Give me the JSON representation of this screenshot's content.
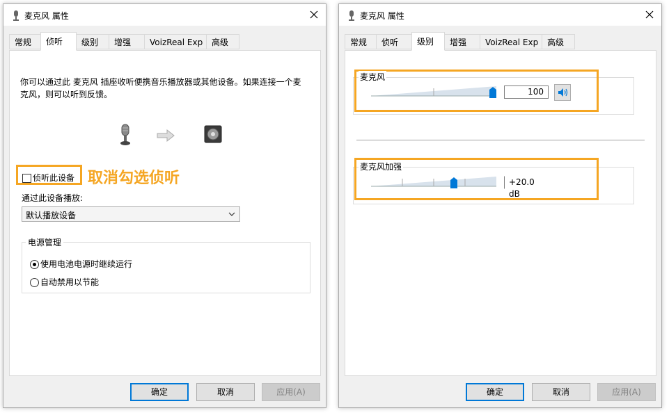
{
  "dialog1": {
    "title": "麦克风 属性",
    "tabs": [
      "常规",
      "侦听",
      "级别",
      "增强",
      "VoizReal Exp",
      "高级"
    ],
    "active_tab": 1,
    "description": "你可以通过此 麦克风 插座收听便携音乐播放器或其他设备。如果连接一个麦克风，则可以听到反馈。",
    "listen_checkbox_label": "侦听此设备",
    "listen_checked": false,
    "annotation": "取消勾选侦听",
    "playback_label": "通过此设备播放:",
    "playback_device": "默认播放设备",
    "power_group_label": "电源管理",
    "power_options": [
      "使用电池电源时继续运行",
      "自动禁用以节能"
    ],
    "power_selected": 0,
    "buttons": {
      "ok": "确定",
      "cancel": "取消",
      "apply": "应用(A)"
    }
  },
  "dialog2": {
    "title": "麦克风 属性",
    "tabs": [
      "常规",
      "侦听",
      "级别",
      "增强",
      "VoizReal Exp",
      "高级"
    ],
    "active_tab": 2,
    "mic_label": "麦克风",
    "mic_level": 100,
    "mic_value": "100",
    "boost_label": "麦克风加强",
    "boost_value": "+20.0 dB",
    "boost_fraction": 0.66,
    "buttons": {
      "ok": "确定",
      "cancel": "取消",
      "apply": "应用(A)"
    }
  },
  "colors": {
    "annotation": "#f5a623",
    "accent": "#0078d7"
  }
}
